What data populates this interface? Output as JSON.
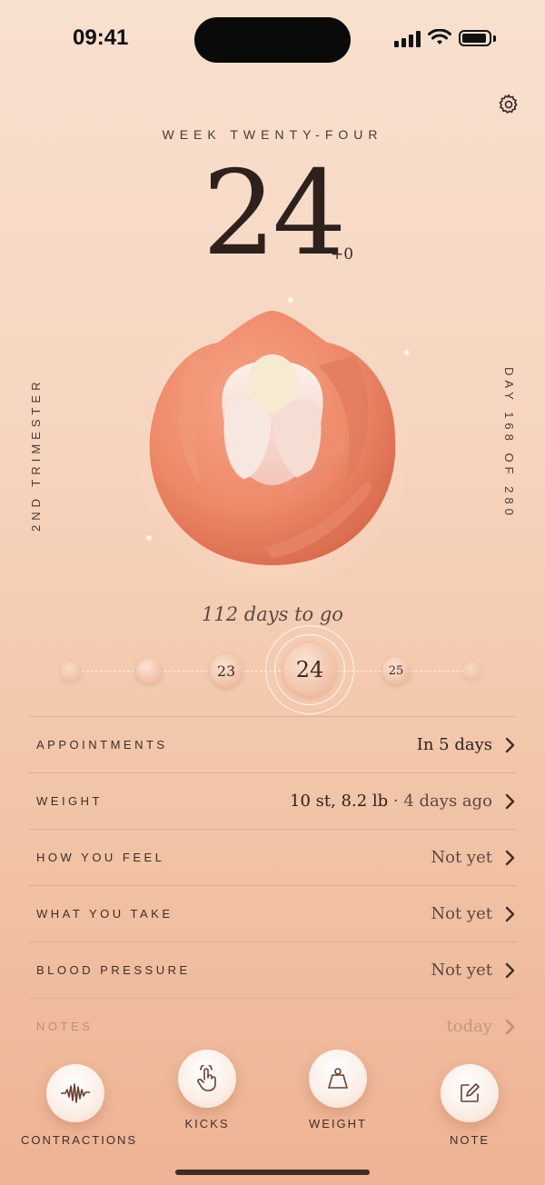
{
  "status": {
    "time": "09:41"
  },
  "header": {
    "week_label": "WEEK TWENTY-FOUR",
    "week_number": "24",
    "days_offset": "+0",
    "trimester": "2ND TRIMESTER",
    "day_progress": "DAY 168 OF 280",
    "days_to_go": "112 days to go"
  },
  "timeline": {
    "prev": "23",
    "current": "24",
    "next": "25"
  },
  "rows": [
    {
      "label": "APPOINTMENTS",
      "value": "In 5 days",
      "extra": ""
    },
    {
      "label": "WEIGHT",
      "value": "10 st, 8.2 lb",
      "extra": " · 4 days ago"
    },
    {
      "label": "HOW YOU FEEL",
      "value": "Not yet",
      "extra": ""
    },
    {
      "label": "WHAT YOU TAKE",
      "value": "Not yet",
      "extra": ""
    },
    {
      "label": "BLOOD PRESSURE",
      "value": "Not yet",
      "extra": ""
    },
    {
      "label": "NOTES",
      "value": "today",
      "extra": ""
    }
  ],
  "tabs": {
    "contractions": "CONTRACTIONS",
    "kicks": "KICKS",
    "weight": "WEIGHT",
    "note": "NOTE"
  },
  "icons": [
    "gear-icon",
    "waveform-icon",
    "hand-tap-icon",
    "scale-weight-icon",
    "edit-note-icon",
    "chevron-right-icon"
  ],
  "colors": {
    "accent": "#e8785e",
    "text": "#2e211c",
    "background_top": "#f8e0cf",
    "background_bottom": "#eeb394"
  }
}
